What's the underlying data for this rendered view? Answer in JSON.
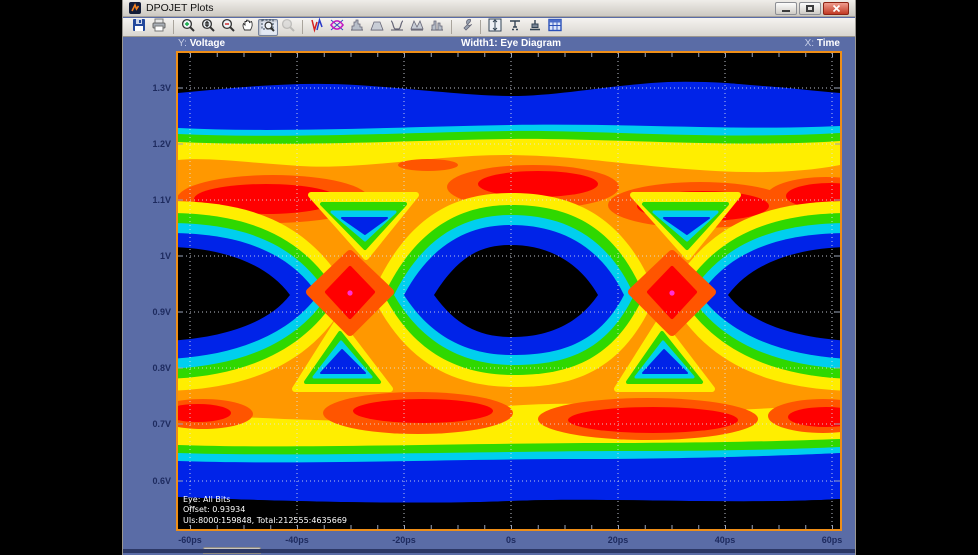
{
  "window": {
    "title": "DPOJET Plots",
    "controls": [
      "minimize",
      "maximize",
      "close"
    ]
  },
  "toolbar": {
    "groups": [
      [
        {
          "icon": "save-icon"
        },
        {
          "icon": "print-icon"
        }
      ],
      [
        {
          "icon": "zoom-in-icon"
        },
        {
          "icon": "zoom-fit-icon"
        },
        {
          "icon": "zoom-out-icon"
        },
        {
          "icon": "pan-hand-icon"
        },
        {
          "icon": "zoom-box-icon",
          "state": "selected"
        },
        {
          "icon": "zoom-undo-icon",
          "state": "disabled"
        }
      ],
      [
        {
          "icon": "trend-plot-icon"
        },
        {
          "icon": "eye-diagram-plot-icon"
        },
        {
          "icon": "histogram-plot-icon"
        },
        {
          "icon": "spectrum-plot-icon"
        },
        {
          "icon": "bathtub-plot-icon"
        },
        {
          "icon": "mask-plot-icon"
        },
        {
          "icon": "jitter-histogram-plot-icon"
        }
      ],
      [
        {
          "icon": "configure-icon"
        }
      ],
      [
        {
          "icon": "vertical-cursors-icon"
        },
        {
          "icon": "horizontal-cursors-icon"
        },
        {
          "icon": "align-icon"
        },
        {
          "icon": "summary-table-icon"
        }
      ]
    ]
  },
  "plot_header": {
    "y_prefix": "Y:",
    "y_label": "Voltage",
    "title": "Width1: Eye Diagram",
    "x_prefix": "X:",
    "x_label": "Time"
  },
  "axes": {
    "y_ticks": [
      "1.3V",
      "1.2V",
      "1.1V",
      "1V",
      "0.9V",
      "0.8V",
      "0.7V",
      "0.6V"
    ],
    "x_ticks": [
      "-60ps",
      "-40ps",
      "-20ps",
      "0s",
      "20ps",
      "40ps",
      "60ps"
    ]
  },
  "annotation": {
    "line1": "Eye: All Bits",
    "line2": "Offset: 0.93934",
    "line3": "UIs:8000:159848, Total:212555:4635669"
  },
  "colors": {
    "content_background": "#5a6ca6",
    "plot_border": "#ee8e17",
    "axis_label": "#1d2a5e",
    "grid_dots": "#dde3ee"
  },
  "chart_data": {
    "type": "heatmap",
    "title": "Width1: Eye Diagram",
    "xlabel": "Time",
    "ylabel": "Voltage",
    "x_ticks": [
      "-60ps",
      "-40ps",
      "-20ps",
      "0s",
      "20ps",
      "40ps",
      "60ps"
    ],
    "y_ticks": [
      "1.3V",
      "1.2V",
      "1.1V",
      "1V",
      "0.9V",
      "0.8V",
      "0.7V",
      "0.6V"
    ],
    "x_range_ps": [
      -62,
      62
    ],
    "y_range_v": [
      0.52,
      1.36
    ],
    "grid": "dotted",
    "palette_cold_to_hot": [
      "#000000",
      "#0023e8",
      "#00cfee",
      "#2fd800",
      "#ffee00",
      "#ff9800",
      "#ff5500",
      "#ff0000",
      "#ff2fd4"
    ],
    "features": {
      "plot_kind": "eye-diagram density map",
      "unit_interval_ps": 60,
      "eye_opening_centers_ps": [
        -60,
        0,
        60
      ],
      "crossing_times_ps": [
        -30,
        30
      ],
      "crossing_voltage_v": 0.93934,
      "high_rail_voltage_v": 1.13,
      "low_rail_voltage_v": 0.73,
      "top_rail_span_v": [
        1.0,
        1.2
      ],
      "bottom_rail_span_v": [
        0.62,
        0.9
      ],
      "population_annotation": [
        "Eye: All Bits",
        "Offset: 0.93934",
        "UIs:8000:159848, Total:212555:4635669"
      ]
    }
  }
}
